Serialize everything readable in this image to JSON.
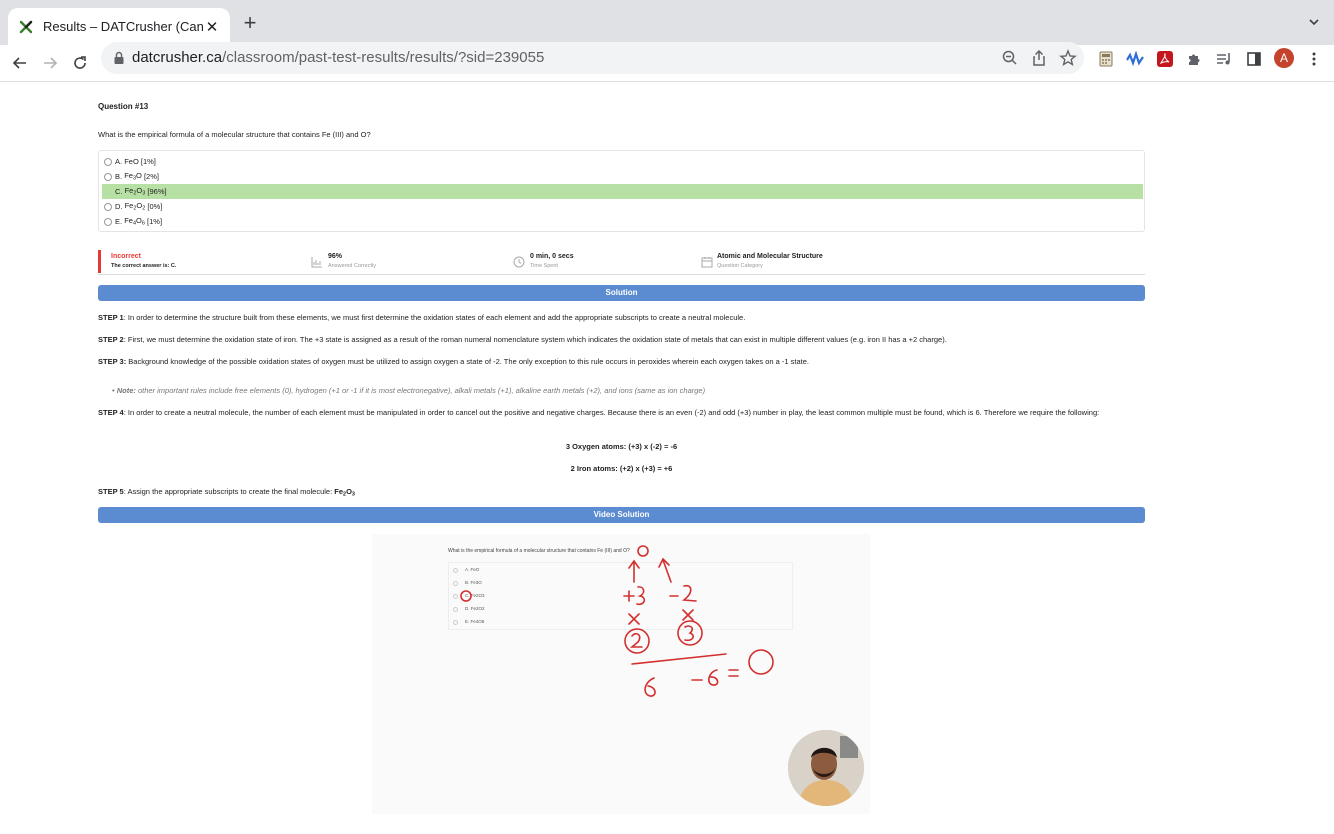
{
  "browser": {
    "tab_title": "Results – DATCrusher (Canadian",
    "tab_close": "✕",
    "new_tab": "+",
    "url_domain": "datcrusher.ca",
    "url_path": "/classroom/past-test-results/results/?sid=239055",
    "profile_initial": "A"
  },
  "question": {
    "number": "Question #13",
    "text": "What is the empirical formula of a molecular structure that contains Fe (III) and O?",
    "answers": [
      {
        "letter": "A.",
        "formula": "FeO",
        "pct": "[1%]"
      },
      {
        "letter": "B.",
        "formula": "Fe3O",
        "pct": "[2%]"
      },
      {
        "letter": "C.",
        "formula": "Fe2O3",
        "pct": "[96%]",
        "correct": true
      },
      {
        "letter": "D.",
        "formula": "Fe2O2",
        "pct": "[0%]"
      },
      {
        "letter": "E.",
        "formula": "Fe4O6",
        "pct": "[1%]"
      }
    ]
  },
  "stats": {
    "result": "Incorrect",
    "correct_answer": "The correct answer is: C.",
    "pct_value": "96%",
    "pct_label": "Answered Correctly",
    "time_value": "0 min, 0 secs",
    "time_label": "Time Spent",
    "category_value": "Atomic and Molecular Structure",
    "category_label": "Question Category"
  },
  "solution": {
    "header": "Solution",
    "step1_label": "STEP 1",
    "step1_text": ": In order to determine the structure built from these elements, we must first determine the oxidation states of each element and add the appropriate subscripts to create a neutral molecule.",
    "step2_label": "STEP 2",
    "step2_text": ": First, we must determine the oxidation state of iron. The +3 state is assigned as a result of the roman numeral nomenclature system which indicates the oxidation state of metals that can exist in multiple different values (e.g. iron II has a +2 charge).",
    "step3_label": "STEP 3:",
    "step3_text": " Background knowledge of the possible oxidation states of oxygen must be utilized to assign oxygen a state of -2. The only exception to this rule occurs in peroxides wherein each oxygen takes on a -1 state.",
    "note_label": "• Note:",
    "note_text": " other important rules include free elements (0), hydrogen (+1 or -1 if it is most electronegative), alkali metals (+1), alkaline earth metals (+2), and ions (same as ion charge)",
    "step4_label": "STEP 4",
    "step4_text": ": In order to create a neutral molecule, the number of each element must be manipulated in order to cancel out the positive and negative charges. Because there is an even (-2) and odd (+3) number in play, the least common multiple must be found, which is 6. Therefore we require the following:",
    "calc1": "3 Oxygen atoms: (+3) x (-2) = -6",
    "calc2": "2 Iron atoms: (+2) x (+3) = +6",
    "step5_label": "STEP 5",
    "step5_text": ": Assign the appropriate subscripts to create the final molecule: "
  },
  "video": {
    "header": "Video Solution",
    "question": "What is the empirical formula of a molecular structure that contains Fe (III) and O?",
    "options": [
      "A. FeO",
      "B. Fe3O",
      "C. Fe2O3",
      "D. Fe2O2",
      "E. Fe4O6"
    ]
  },
  "colors": {
    "correct_row": "#b7e1a4",
    "banner": "#5b8bd1",
    "incorrect": "#e53935",
    "ink": "#d32f2f"
  }
}
